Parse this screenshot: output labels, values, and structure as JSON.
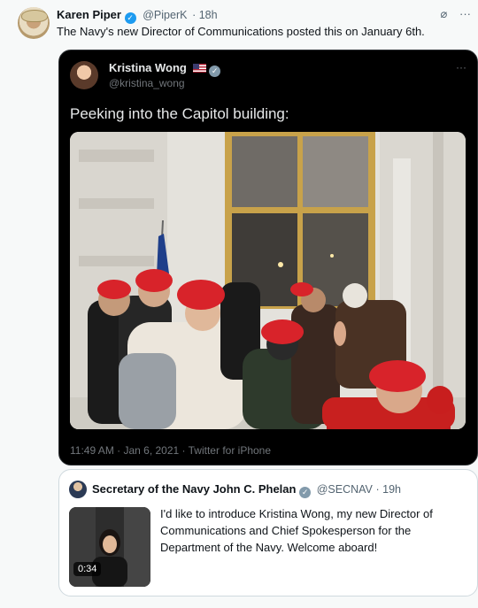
{
  "outer_tweet": {
    "author": "Karen Piper",
    "handle": "@PiperK",
    "time": "· 18h",
    "text": "The Navy's new Director of Communications posted this on January 6th.",
    "icons": [
      "verified-badge-icon",
      "grok-icon",
      "more-icon"
    ]
  },
  "quoted_tweet": {
    "author": "Kristina Wong",
    "handle": "@kristina_wong",
    "text": "Peeking into the Capitol building:",
    "meta": "11:49 AM · Jan 6, 2021 · Twitter for iPhone",
    "more": "···"
  },
  "nested_quote": {
    "author": "Secretary of the Navy John C. Phelan",
    "handle": "@SECNAV",
    "time": "· 19h",
    "text": "I'd like to introduce Kristina Wong, my new Director of Communications and Chief Spokesperson for the Department of the Navy. Welcome aboard!",
    "video_duration": "0:34"
  },
  "colors": {
    "accent": "#1d9bf0",
    "dark_card": "#000000",
    "muted": "#536471",
    "hat_red": "#d8232a"
  }
}
